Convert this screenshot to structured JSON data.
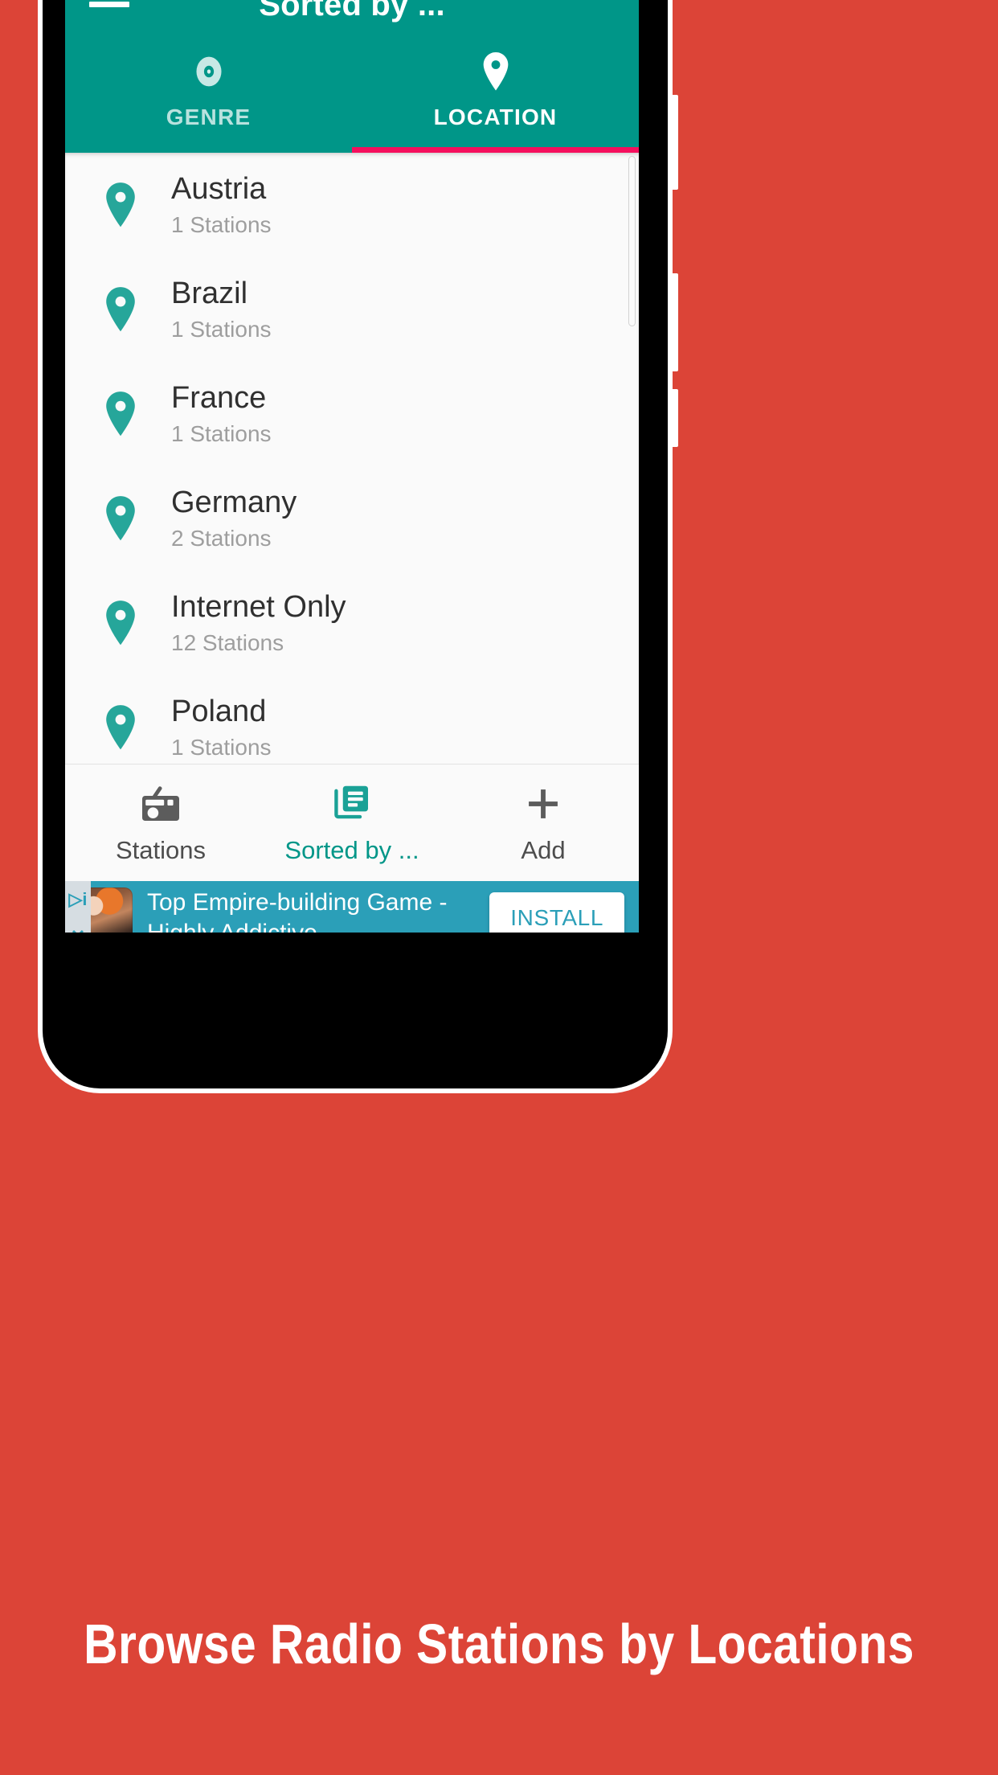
{
  "background_color": "#dc4437",
  "app": {
    "accent_teal": "#009688",
    "indicator_pink": "#f50f5d",
    "appbar": {
      "title": "Sorted by ...",
      "menu_icon": "hamburger-menu-icon"
    },
    "tabs": [
      {
        "label": "GENRE",
        "icon": "disc-icon",
        "active": false
      },
      {
        "label": "LOCATION",
        "icon": "location-pin-icon",
        "active": true
      }
    ],
    "list": {
      "pin_icon": "location-pin-icon",
      "pin_color": "#26a69a",
      "items": [
        {
          "name": "Austria",
          "stations": "1 Stations"
        },
        {
          "name": "Brazil",
          "stations": "1 Stations"
        },
        {
          "name": "France",
          "stations": "1 Stations"
        },
        {
          "name": "Germany",
          "stations": "2 Stations"
        },
        {
          "name": "Internet Only",
          "stations": "12 Stations"
        },
        {
          "name": "Poland",
          "stations": "1 Stations"
        }
      ]
    },
    "bottom_nav": [
      {
        "label": "Stations",
        "icon": "radio-icon",
        "active": false
      },
      {
        "label": "Sorted by ...",
        "icon": "article-icon",
        "active": true
      },
      {
        "label": "Add",
        "icon": "plus-icon",
        "active": false
      }
    ]
  },
  "ad": {
    "background_color": "#2b9fb8",
    "headline": "Top Empire-building Game -Highly Addictive",
    "install_label": "INSTALL",
    "thumbnail": "game-artwork-thumbnail",
    "badge_info": "▷i",
    "badge_close": "✕"
  },
  "caption": "Browse Radio Stations by Locations"
}
